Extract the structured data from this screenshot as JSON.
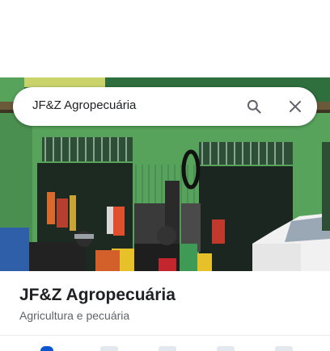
{
  "search": {
    "query": "JF&Z Agropecuária",
    "search_icon": "search-icon",
    "close_icon": "close-icon"
  },
  "place": {
    "name": "JF&Z Agropecuária",
    "category": "Agricultura e pecuária",
    "photo_icon": "storefront-photo"
  },
  "actions": [
    {
      "icon": "directions-icon"
    },
    {
      "icon": "save-icon"
    },
    {
      "icon": "nearby-icon"
    },
    {
      "icon": "share-icon"
    },
    {
      "icon": "call-icon"
    }
  ],
  "colors": {
    "accent": "#0b57d0",
    "storefront_green": "#4f9a55",
    "text_primary": "#202124",
    "text_secondary": "#5f6368"
  }
}
